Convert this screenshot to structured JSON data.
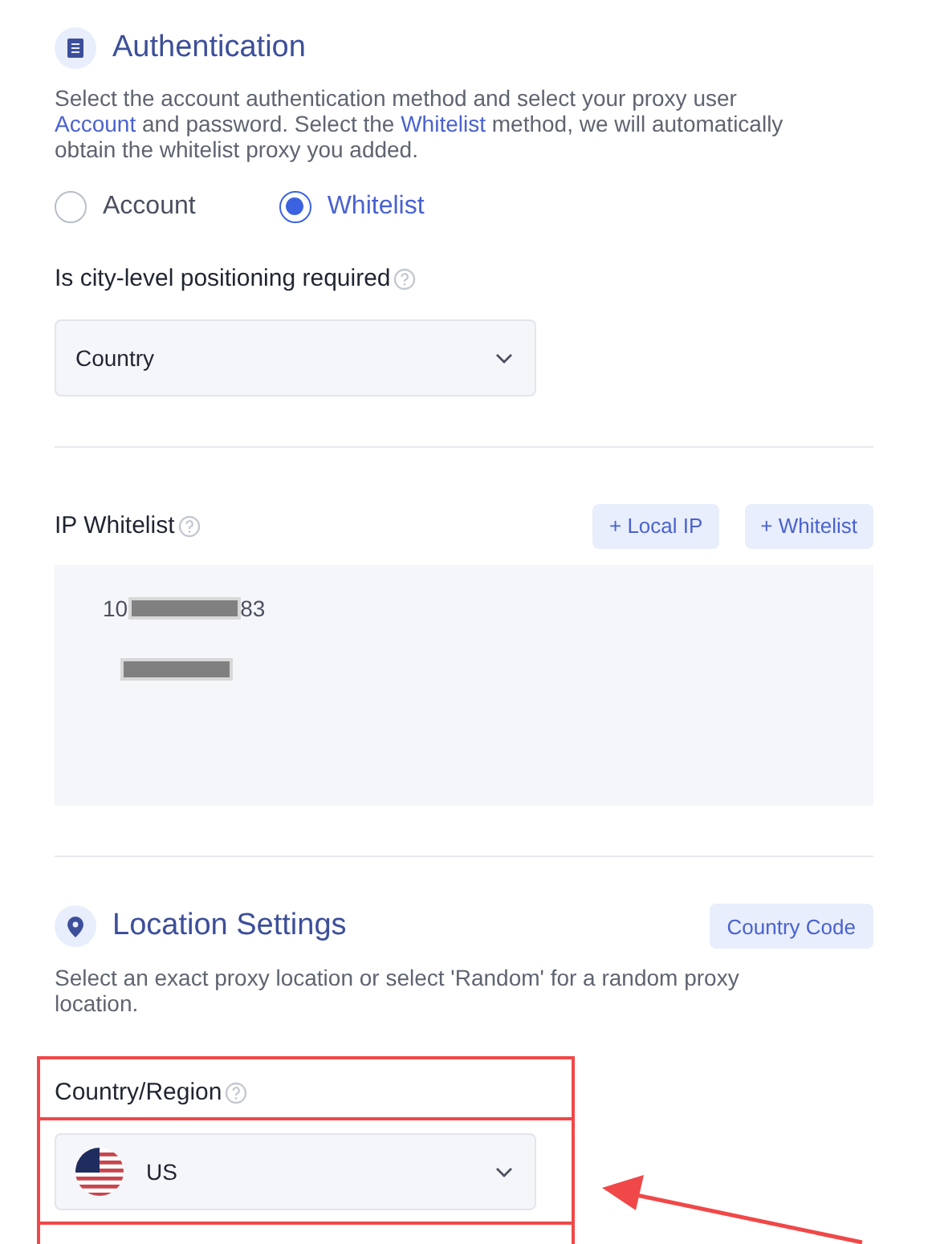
{
  "authentication": {
    "title": "Authentication",
    "description": "Select the account authentication method and select your proxy user ",
    "link_account": "Account",
    "description_2": " and password. Select the ",
    "link_whitelist": "Whitelist",
    "description_3": " method, we will automatically obtain the whitelist proxy you added.",
    "methods": [
      {
        "label": "Account",
        "selected": false
      },
      {
        "label": "Whitelist",
        "selected": true
      }
    ],
    "city_label": "Is city-level positioning required",
    "city_select": {
      "value": "Country"
    }
  },
  "ip_whitelist": {
    "label": "IP Whitelist",
    "buttons": [
      "+ Local IP",
      "+ Whitelist"
    ],
    "entries": [
      {
        "before": "10",
        "after": "83",
        "redacted": true
      },
      {
        "redacted": true
      }
    ]
  },
  "location": {
    "title": "Location Settings",
    "button": "Country Code",
    "description": "Select an exact proxy location or select 'Random' for a random proxy location.",
    "country_label": "Country/Region",
    "country_select": {
      "value": "US"
    }
  }
}
